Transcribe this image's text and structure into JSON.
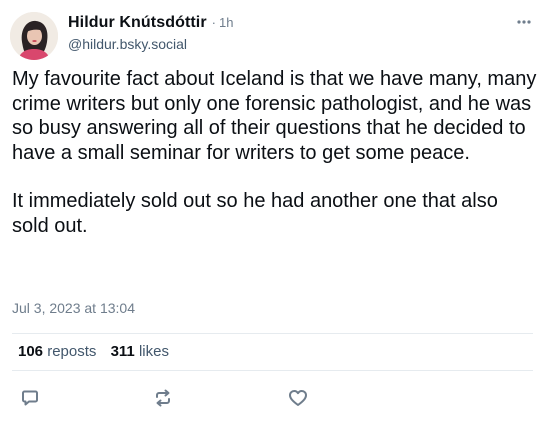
{
  "author": {
    "display_name": "Hildur Knútsdóttir",
    "separator": "·",
    "time_ago": "1h",
    "handle": "@hildur.bsky.social"
  },
  "post": {
    "paragraphs": [
      "My favourite fact about Iceland is that we have many, many crime writers but only one forensic pathologist, and he was so busy answering all of their questions that he decided to have a small seminar for writers to get some peace.",
      "It immediately sold out so he had another one that also sold out."
    ],
    "date": "Jul 3, 2023 at 13:04"
  },
  "stats": {
    "reposts_count": "106",
    "reposts_label": "reposts",
    "likes_count": "311",
    "likes_label": "likes"
  },
  "icons": {
    "more": "ellipsis-icon",
    "reply": "reply-bubble-icon",
    "repost": "repost-arrows-icon",
    "like": "heart-icon"
  },
  "colors": {
    "text_primary": "#0b0f14",
    "text_secondary": "#6f7d8c",
    "icon": "#6f7d8c",
    "divider": "#e6ebef"
  }
}
